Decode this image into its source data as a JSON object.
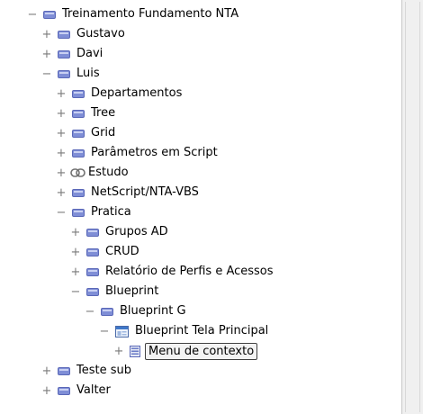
{
  "tree": {
    "nodes": [
      {
        "label": "Treinamento Fundamento NTA",
        "toggle": "−",
        "icon": "folder-bar-icon"
      },
      {
        "label": "Gustavo",
        "toggle": "+",
        "icon": "folder-bar-icon"
      },
      {
        "label": "Davi",
        "toggle": "+",
        "icon": "folder-bar-icon"
      },
      {
        "label": "Luis",
        "toggle": "−",
        "icon": "folder-bar-icon"
      },
      {
        "label": "Departamentos",
        "toggle": "+",
        "icon": "folder-bar-icon"
      },
      {
        "label": "Tree",
        "toggle": "+",
        "icon": "folder-bar-icon"
      },
      {
        "label": "Grid",
        "toggle": "+",
        "icon": "folder-bar-icon"
      },
      {
        "label": "Parâmetros em Script",
        "toggle": "+",
        "icon": "folder-bar-icon"
      },
      {
        "label": "Estudo",
        "toggle": "+",
        "icon": "link-icon"
      },
      {
        "label": "NetScript/NTA-VBS",
        "toggle": "+",
        "icon": "folder-bar-icon"
      },
      {
        "label": "Pratica",
        "toggle": "−",
        "icon": "folder-bar-icon"
      },
      {
        "label": "Grupos AD",
        "toggle": "+",
        "icon": "folder-bar-icon"
      },
      {
        "label": "CRUD",
        "toggle": "+",
        "icon": "folder-bar-icon"
      },
      {
        "label": "Relatório de Perfis e Acessos",
        "toggle": "+",
        "icon": "folder-bar-icon"
      },
      {
        "label": "Blueprint",
        "toggle": "−",
        "icon": "folder-bar-icon"
      },
      {
        "label": "Blueprint G",
        "toggle": "−",
        "icon": "folder-bar-icon"
      },
      {
        "label": "Blueprint Tela Principal",
        "toggle": "−",
        "icon": "window-icon"
      },
      {
        "label": "Menu de contexto",
        "toggle": "+",
        "icon": "menu-icon",
        "selected": true
      },
      {
        "label": "Teste sub",
        "toggle": "+",
        "icon": "folder-bar-icon"
      },
      {
        "label": "Valter",
        "toggle": "+",
        "icon": "folder-bar-icon"
      }
    ]
  },
  "colors": {
    "folder_bar": "#7f8ed6",
    "toggle": "#7a7a7a",
    "selection_border": "#404040"
  }
}
